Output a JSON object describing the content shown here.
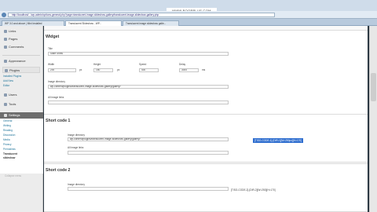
{
  "watermark": "WWW.BOOPPLUS.COM",
  "browser": {
    "url": "http://localhost/.../wp-admin/options-general.php?page=translucent-image-slideshow-gallery/translucent-image-slideshow-gallery.php",
    "tabs": [
      {
        "label": "WP 3.0 and above | Mini Installed"
      },
      {
        "label": "Translucent Slideshow - WP..."
      },
      {
        "label": "Translucent image slideshow galle..."
      }
    ]
  },
  "sidebar": {
    "top_items": [
      "Links",
      "Pages",
      "Comments"
    ],
    "appearance": "Appearance",
    "plugins": "Plugins",
    "plugins_sub": [
      "Installed Plugins",
      "Add New",
      "Editor"
    ],
    "users": "Users",
    "tools": "Tools",
    "settings": "Settings",
    "settings_sub": [
      "General",
      "Writing",
      "Reading",
      "Discussion",
      "Media",
      "Privacy",
      "Permalinks",
      "Translucent",
      "slideshow"
    ],
    "collapse": "Collapse menu"
  },
  "widget": {
    "heading": "Widget",
    "title_label": "Title",
    "title_value": "Slide Show",
    "width_label": "Width",
    "width_value": "200",
    "height_label": "Height",
    "height_value": "150",
    "speed_label": "Speed",
    "speed_value": "400",
    "delay_label": "Delay",
    "delay_value": "3000",
    "unit_px": "px",
    "unit_ms": "ms",
    "dir_label": "Image directory",
    "dir_value": "wp-content/plugins/translucent-image-slideshow-gallery/gallery/",
    "link_label": "All image links"
  },
  "shortcode1": {
    "heading": "Short code 1",
    "dir_label": "Image directory",
    "dir_value": "wp-content/plugins/translucent-image-slideshow-gallery/gallery/",
    "link_label": "All image links",
    "code": "[TISG-CODE-1]-[DIR-1][W=250px][H=170]"
  },
  "shortcode2": {
    "heading": "Short code 2",
    "dir_label": "Image directory",
    "code": "[TISG-CODE-2]-[DIR-2][W=250][H=170]"
  }
}
